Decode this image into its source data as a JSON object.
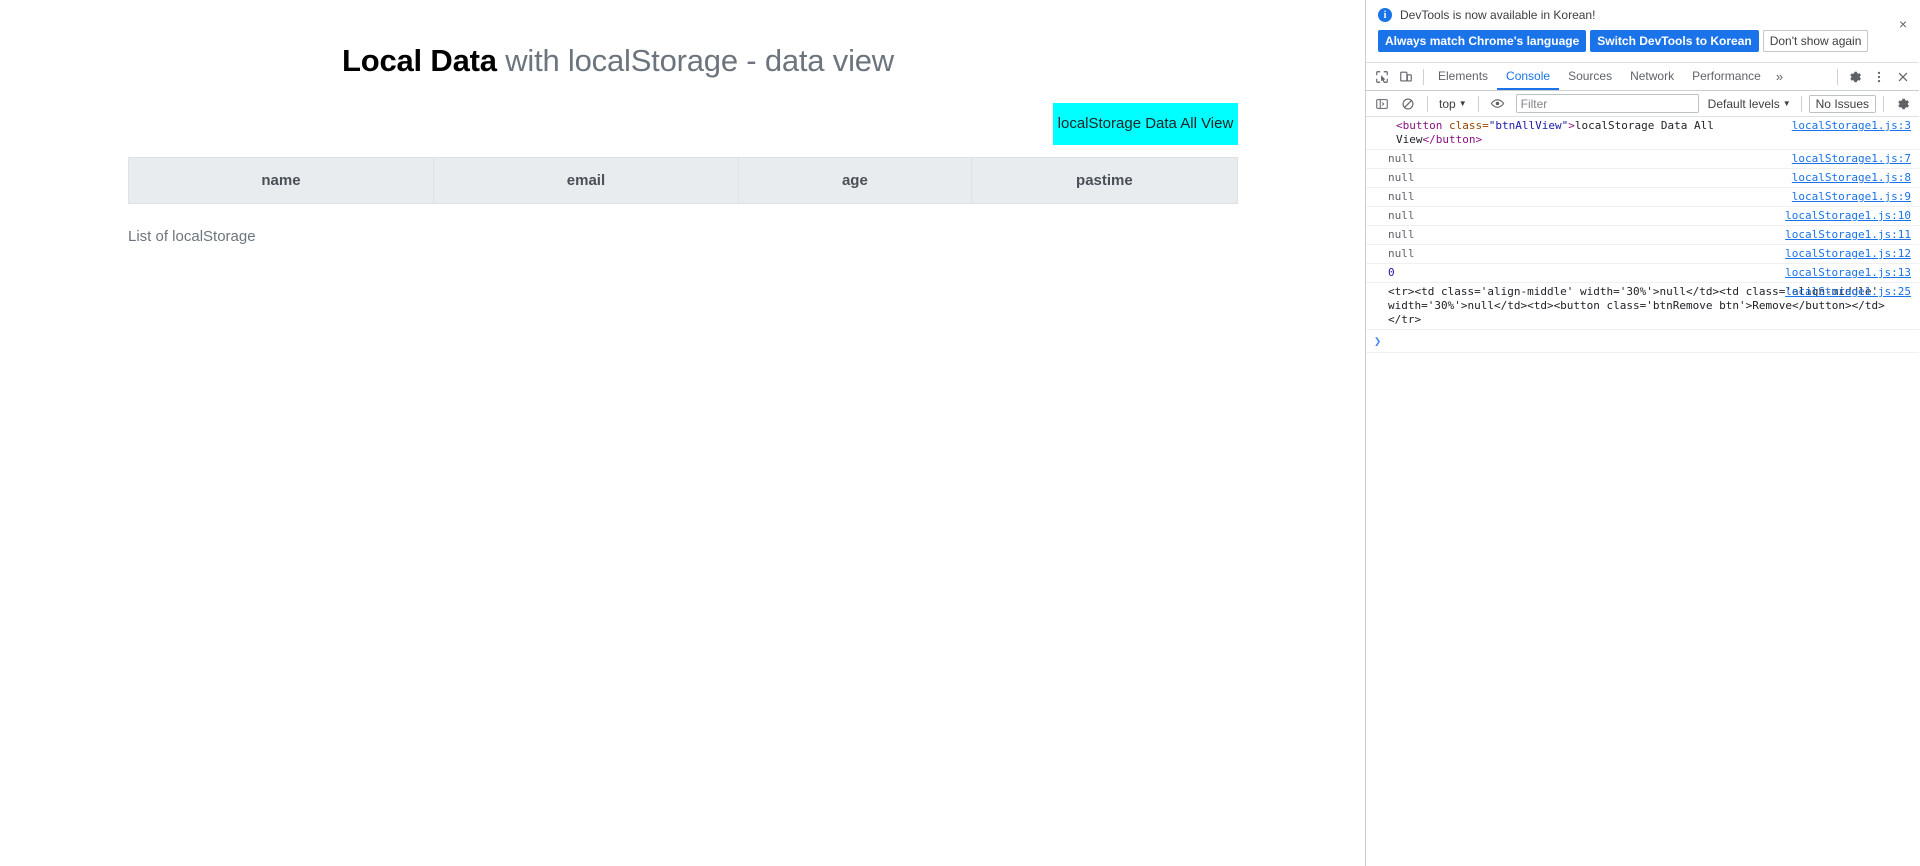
{
  "page": {
    "title_strong": "Local Data",
    "title_rest": " with localStorage - data view",
    "all_view_button": "localStorage Data All View",
    "table": {
      "headers": [
        "name",
        "email",
        "age",
        "pastime"
      ],
      "rows": []
    },
    "list_caption": "List of localStorage",
    "accent_button_color": "#00ffff"
  },
  "devtools": {
    "notice": {
      "message": "DevTools is now available in Korean!",
      "buttons": [
        {
          "label": "Always match Chrome's language",
          "style": "primary"
        },
        {
          "label": "Switch DevTools to Korean",
          "style": "primary"
        },
        {
          "label": "Don't show again",
          "style": "plain"
        }
      ],
      "close_label": "×"
    },
    "tabs": [
      {
        "label": "Elements",
        "active": false
      },
      {
        "label": "Console",
        "active": true
      },
      {
        "label": "Sources",
        "active": false
      },
      {
        "label": "Network",
        "active": false
      },
      {
        "label": "Performance",
        "active": false
      }
    ],
    "more_tabs_label": "»",
    "console_toolbar": {
      "context": "top",
      "filter_placeholder": "Filter",
      "filter_value": "",
      "levels": "Default levels",
      "issues": "No Issues"
    },
    "messages": [
      {
        "kind": "html",
        "source": "localStorage1.js:3",
        "parts": [
          {
            "t": "tag",
            "v": "<button "
          },
          {
            "t": "attr",
            "v": "class="
          },
          {
            "t": "val",
            "v": "\"btnAllView\""
          },
          {
            "t": "tag",
            "v": ">"
          },
          {
            "t": "txt",
            "v": "localStorage Data All View"
          },
          {
            "t": "tag",
            "v": "</button>"
          }
        ]
      },
      {
        "kind": "null",
        "text": "null",
        "source": "localStorage1.js:7"
      },
      {
        "kind": "null",
        "text": "null",
        "source": "localStorage1.js:8"
      },
      {
        "kind": "null",
        "text": "null",
        "source": "localStorage1.js:9"
      },
      {
        "kind": "null",
        "text": "null",
        "source": "localStorage1.js:10"
      },
      {
        "kind": "null",
        "text": "null",
        "source": "localStorage1.js:11"
      },
      {
        "kind": "null",
        "text": "null",
        "source": "localStorage1.js:12"
      },
      {
        "kind": "number",
        "text": "0",
        "source": "localStorage1.js:13"
      },
      {
        "kind": "text",
        "text": "<tr><td class='align-middle' width='30%'>null</td><td class='align-middle' width='30%'>null</td><td><button class='btnRemove btn'>Remove</button></td></tr>",
        "source": "localStorage1.js:25"
      }
    ],
    "prompt_symbol": "❯"
  }
}
